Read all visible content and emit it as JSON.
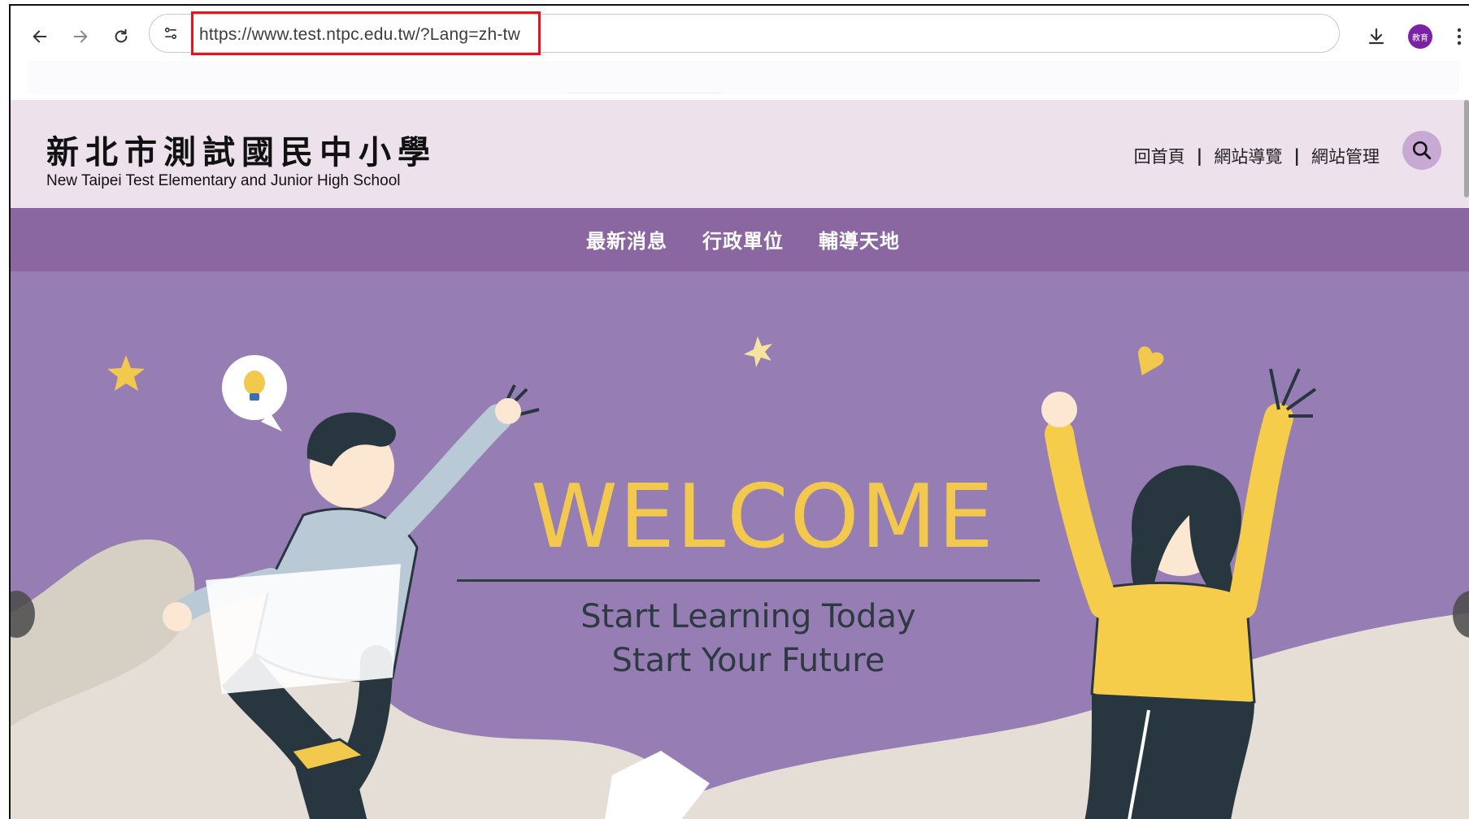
{
  "browser": {
    "url": "https://www.test.ntpc.edu.tw/?Lang=zh-tw",
    "profile_label": "教育"
  },
  "header": {
    "school_name_cn": "新北市測試國民中小學",
    "school_name_en": "New Taipei Test Elementary and Junior High School",
    "links": [
      {
        "label": "回首頁"
      },
      {
        "label": "網站導覽"
      },
      {
        "label": "網站管理"
      }
    ],
    "separator": "|"
  },
  "nav": {
    "items": [
      {
        "label": "最新消息"
      },
      {
        "label": "行政單位"
      },
      {
        "label": "輔導天地"
      }
    ]
  },
  "hero": {
    "headline": "WELCOME",
    "tagline_1": "Start Learning Today",
    "tagline_2": "Start Your Future"
  },
  "colors": {
    "header_bg": "#ede1ec",
    "nav_bg": "#8a67a1",
    "hero_bg": "#967eb4",
    "welcome_yellow": "#f2c94c",
    "highlight_red": "#e2161f"
  },
  "icons": [
    "back-arrow-icon",
    "forward-arrow-icon",
    "reload-icon",
    "site-info-icon",
    "download-icon",
    "more-vert-icon",
    "search-icon"
  ]
}
